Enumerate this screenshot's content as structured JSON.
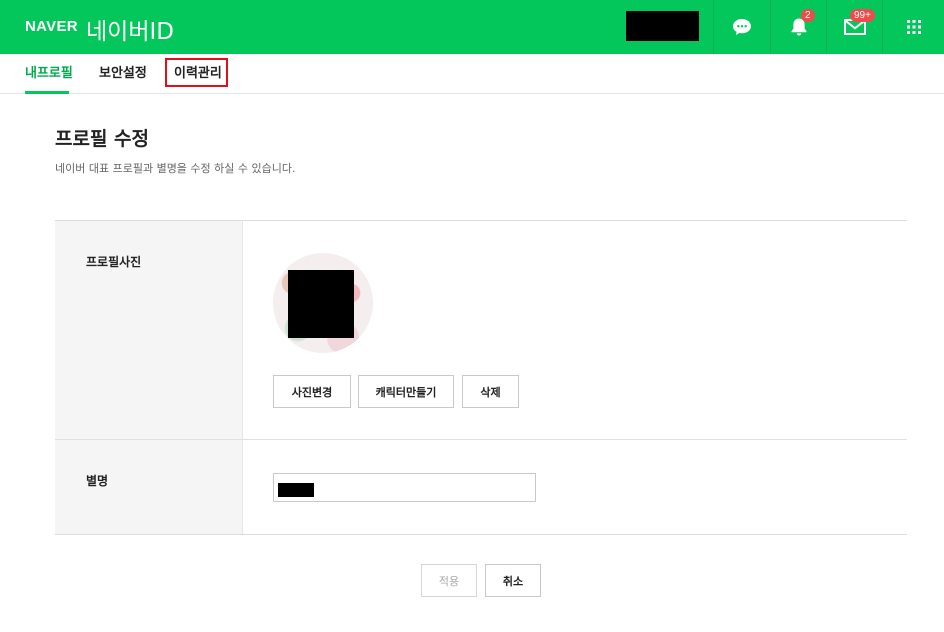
{
  "header": {
    "logo": "NAVER",
    "service_title": "네이버ID",
    "notification_count": "2",
    "mail_count": "99+",
    "accent_color": "#03c75a"
  },
  "tabs": [
    {
      "label": "내프로필",
      "active": true
    },
    {
      "label": "보안설정",
      "active": false
    },
    {
      "label": "이력관리",
      "active": false,
      "highlighted": true
    }
  ],
  "page": {
    "title": "프로필 수정",
    "description": "네이버 대표 프로필과 별명을 수정 하실 수 있습니다."
  },
  "form": {
    "photo_label": "프로필사진",
    "photo_buttons": [
      "사진변경",
      "캐릭터만들기",
      "삭제"
    ],
    "nickname_label": "별명",
    "nickname_value": ""
  },
  "actions": {
    "apply": "적용",
    "cancel": "취소"
  },
  "icons": [
    "talk-icon",
    "bell-icon",
    "mail-icon",
    "apps-grid-icon"
  ]
}
